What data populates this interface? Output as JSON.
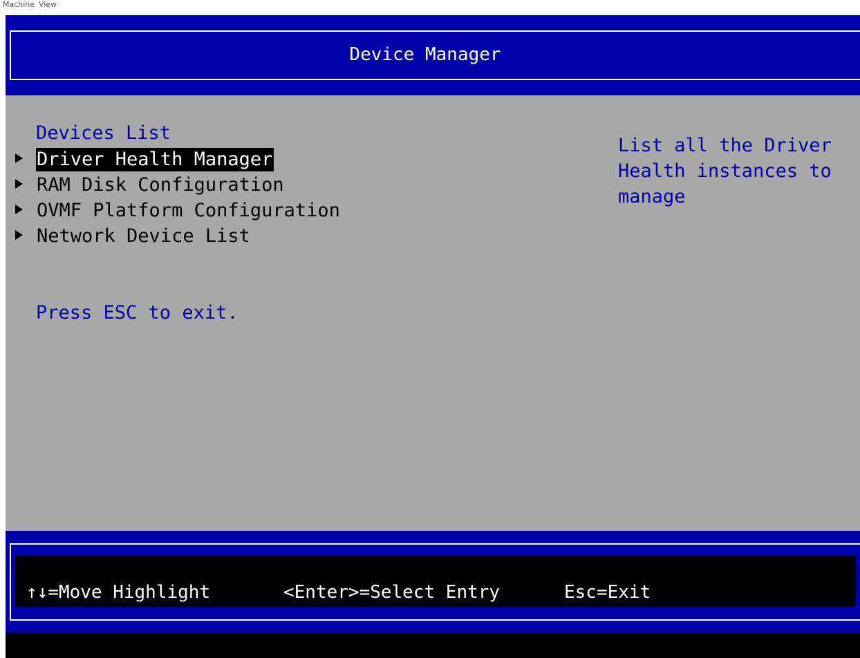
{
  "window_menu": {
    "items": [
      "Machine",
      "View"
    ]
  },
  "colors": {
    "header_blue": "#0000a8",
    "body_gray": "#a8a8a8",
    "help_text_blue": "#0000a8",
    "highlight_bg": "#000000",
    "highlight_fg": "#ffffff"
  },
  "header": {
    "title": "Device Manager"
  },
  "main": {
    "section_title": "Devices List",
    "items": [
      {
        "label": "Driver Health Manager",
        "icon": "triangle-right-icon",
        "selected": true
      },
      {
        "label": "RAM Disk Configuration",
        "icon": "triangle-right-icon",
        "selected": false
      },
      {
        "label": "OVMF Platform Configuration",
        "icon": "triangle-right-icon",
        "selected": false
      },
      {
        "label": "Network Device List",
        "icon": "triangle-right-icon",
        "selected": false
      }
    ],
    "exit_hint": "Press ESC to exit."
  },
  "help_panel": {
    "lines": [
      "List all the Driver",
      "Health instances to",
      "manage"
    ]
  },
  "footer": {
    "move_hint": "↑↓=Move Highlight",
    "enter_hint": "<Enter>=Select Entry",
    "esc_hint": "Esc=Exit"
  }
}
